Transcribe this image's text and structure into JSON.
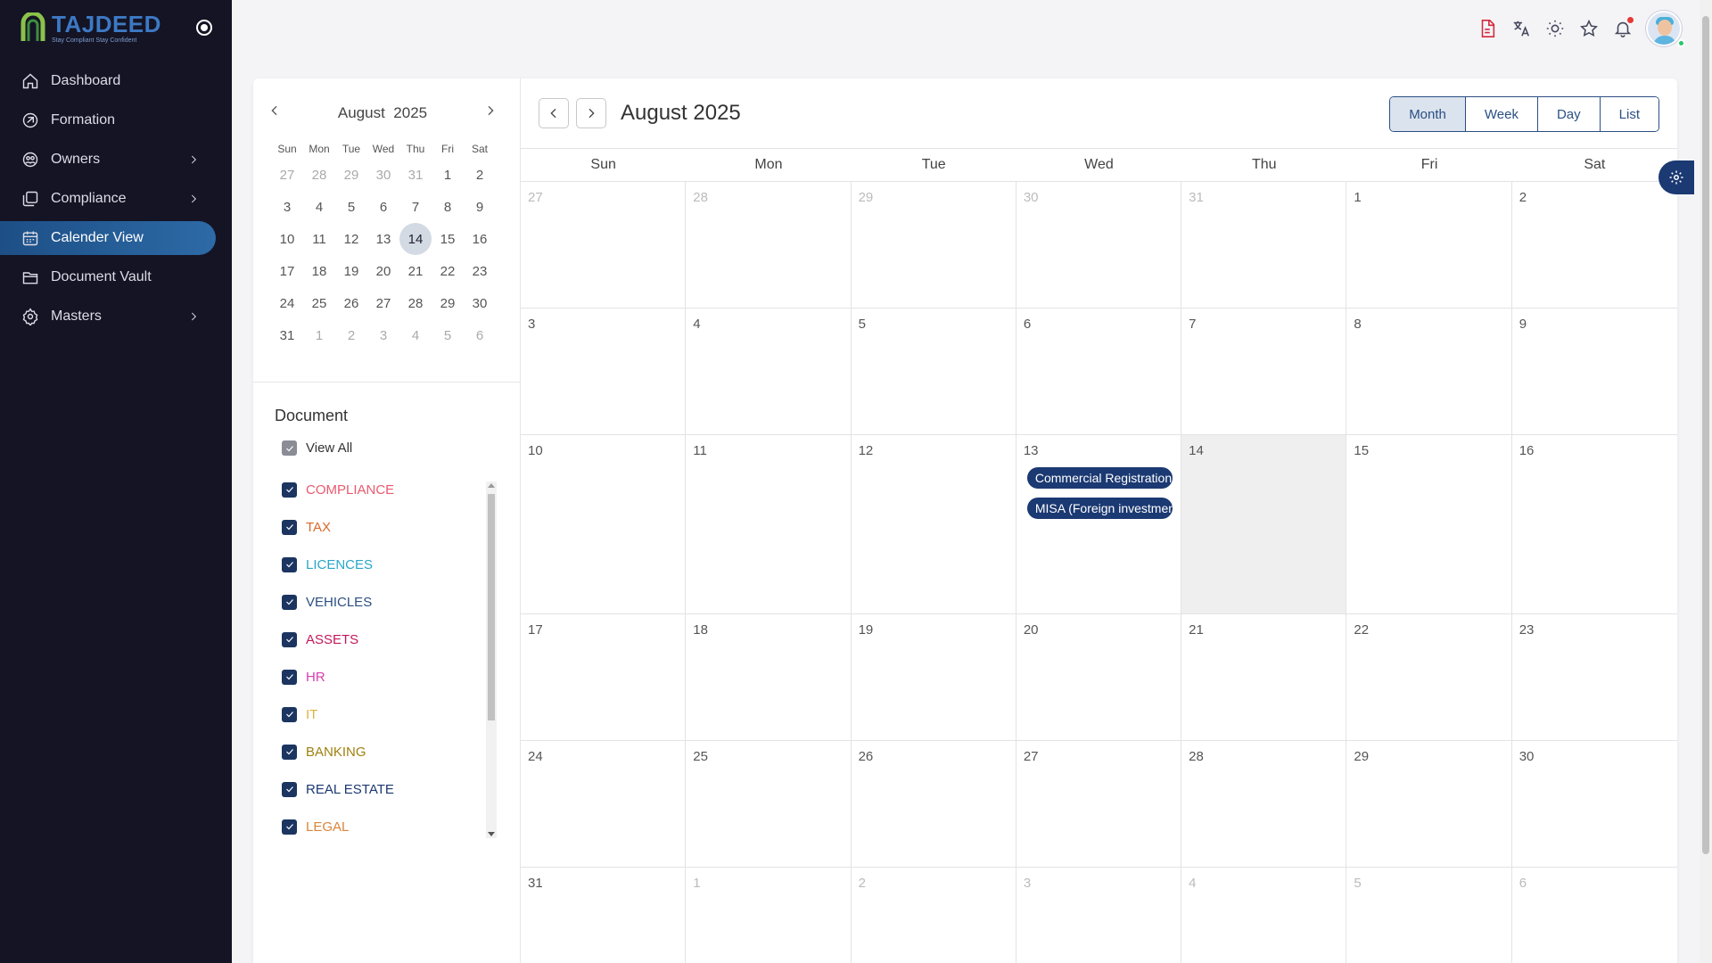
{
  "brand": {
    "name": "TAJDEED",
    "tagline": "Stay Compliant Stay Confident"
  },
  "nav": [
    {
      "label": "Dashboard",
      "icon": "home-icon",
      "chevron": false,
      "active": false
    },
    {
      "label": "Formation",
      "icon": "formation-icon",
      "chevron": false,
      "active": false
    },
    {
      "label": "Owners",
      "icon": "owners-icon",
      "chevron": true,
      "active": false
    },
    {
      "label": "Compliance",
      "icon": "compliance-icon",
      "chevron": true,
      "active": false
    },
    {
      "label": "Calender View",
      "icon": "calendar-icon",
      "chevron": false,
      "active": true
    },
    {
      "label": "Document Vault",
      "icon": "folder-icon",
      "chevron": false,
      "active": false
    },
    {
      "label": "Masters",
      "icon": "settings-icon",
      "chevron": true,
      "active": false
    }
  ],
  "mini_calendar": {
    "month": "August",
    "year": "2025",
    "dow": [
      "Sun",
      "Mon",
      "Tue",
      "Wed",
      "Thu",
      "Fri",
      "Sat"
    ],
    "weeks": [
      [
        {
          "d": "27",
          "m": 1
        },
        {
          "d": "28",
          "m": 1
        },
        {
          "d": "29",
          "m": 1
        },
        {
          "d": "30",
          "m": 1
        },
        {
          "d": "31",
          "m": 1
        },
        {
          "d": "1",
          "m": 0
        },
        {
          "d": "2",
          "m": 0
        }
      ],
      [
        {
          "d": "3",
          "m": 0
        },
        {
          "d": "4",
          "m": 0
        },
        {
          "d": "5",
          "m": 0
        },
        {
          "d": "6",
          "m": 0
        },
        {
          "d": "7",
          "m": 0
        },
        {
          "d": "8",
          "m": 0
        },
        {
          "d": "9",
          "m": 0
        }
      ],
      [
        {
          "d": "10",
          "m": 0
        },
        {
          "d": "11",
          "m": 0
        },
        {
          "d": "12",
          "m": 0
        },
        {
          "d": "13",
          "m": 0
        },
        {
          "d": "14",
          "m": 0,
          "today": 1
        },
        {
          "d": "15",
          "m": 0
        },
        {
          "d": "16",
          "m": 0
        }
      ],
      [
        {
          "d": "17",
          "m": 0
        },
        {
          "d": "18",
          "m": 0
        },
        {
          "d": "19",
          "m": 0
        },
        {
          "d": "20",
          "m": 0
        },
        {
          "d": "21",
          "m": 0
        },
        {
          "d": "22",
          "m": 0
        },
        {
          "d": "23",
          "m": 0
        }
      ],
      [
        {
          "d": "24",
          "m": 0
        },
        {
          "d": "25",
          "m": 0
        },
        {
          "d": "26",
          "m": 0
        },
        {
          "d": "27",
          "m": 0
        },
        {
          "d": "28",
          "m": 0
        },
        {
          "d": "29",
          "m": 0
        },
        {
          "d": "30",
          "m": 0
        }
      ],
      [
        {
          "d": "31",
          "m": 0
        },
        {
          "d": "1",
          "m": 1
        },
        {
          "d": "2",
          "m": 1
        },
        {
          "d": "3",
          "m": 1
        },
        {
          "d": "4",
          "m": 1
        },
        {
          "d": "5",
          "m": 1
        },
        {
          "d": "6",
          "m": 1
        }
      ]
    ]
  },
  "filters": {
    "title": "Document",
    "view_all": "View All",
    "items": [
      {
        "label": "COMPLIANCE",
        "color": "#e85a6f"
      },
      {
        "label": "TAX",
        "color": "#d9682a"
      },
      {
        "label": "LICENCES",
        "color": "#2aa6c9"
      },
      {
        "label": "VEHICLES",
        "color": "#2b4f83"
      },
      {
        "label": "ASSETS",
        "color": "#c2185b"
      },
      {
        "label": "HR",
        "color": "#d63fb1"
      },
      {
        "label": "IT",
        "color": "#e0b040"
      },
      {
        "label": "BANKING",
        "color": "#a08010"
      },
      {
        "label": "REAL ESTATE",
        "color": "#1b3972"
      },
      {
        "label": "LEGAL",
        "color": "#d9843a"
      }
    ]
  },
  "calendar": {
    "title": "August 2025",
    "views": [
      "Month",
      "Week",
      "Day",
      "List"
    ],
    "active_view": "Month",
    "dow": [
      "Sun",
      "Mon",
      "Tue",
      "Wed",
      "Thu",
      "Fri",
      "Sat"
    ],
    "weeks": [
      [
        {
          "d": "27",
          "m": 1
        },
        {
          "d": "28",
          "m": 1
        },
        {
          "d": "29",
          "m": 1
        },
        {
          "d": "30",
          "m": 1
        },
        {
          "d": "31",
          "m": 1
        },
        {
          "d": "1",
          "m": 0
        },
        {
          "d": "2",
          "m": 0
        }
      ],
      [
        {
          "d": "3",
          "m": 0
        },
        {
          "d": "4",
          "m": 0
        },
        {
          "d": "5",
          "m": 0
        },
        {
          "d": "6",
          "m": 0
        },
        {
          "d": "7",
          "m": 0
        },
        {
          "d": "8",
          "m": 0
        },
        {
          "d": "9",
          "m": 0
        }
      ],
      [
        {
          "d": "10",
          "m": 0
        },
        {
          "d": "11",
          "m": 0
        },
        {
          "d": "12",
          "m": 0
        },
        {
          "d": "13",
          "m": 0,
          "events": [
            "Commercial Registration",
            "MISA (Foreign investment)"
          ]
        },
        {
          "d": "14",
          "m": 0,
          "today": 1
        },
        {
          "d": "15",
          "m": 0
        },
        {
          "d": "16",
          "m": 0
        }
      ],
      [
        {
          "d": "17",
          "m": 0
        },
        {
          "d": "18",
          "m": 0
        },
        {
          "d": "19",
          "m": 0
        },
        {
          "d": "20",
          "m": 0
        },
        {
          "d": "21",
          "m": 0
        },
        {
          "d": "22",
          "m": 0
        },
        {
          "d": "23",
          "m": 0
        }
      ],
      [
        {
          "d": "24",
          "m": 0
        },
        {
          "d": "25",
          "m": 0
        },
        {
          "d": "26",
          "m": 0
        },
        {
          "d": "27",
          "m": 0
        },
        {
          "d": "28",
          "m": 0
        },
        {
          "d": "29",
          "m": 0
        },
        {
          "d": "30",
          "m": 0
        }
      ],
      [
        {
          "d": "31",
          "m": 0
        },
        {
          "d": "1",
          "m": 1
        },
        {
          "d": "2",
          "m": 1
        },
        {
          "d": "3",
          "m": 1
        },
        {
          "d": "4",
          "m": 1
        },
        {
          "d": "5",
          "m": 1
        },
        {
          "d": "6",
          "m": 1
        }
      ]
    ]
  },
  "topbar_icons": [
    "pdf-icon",
    "translate-icon",
    "sun-icon",
    "star-icon",
    "bell-icon"
  ]
}
